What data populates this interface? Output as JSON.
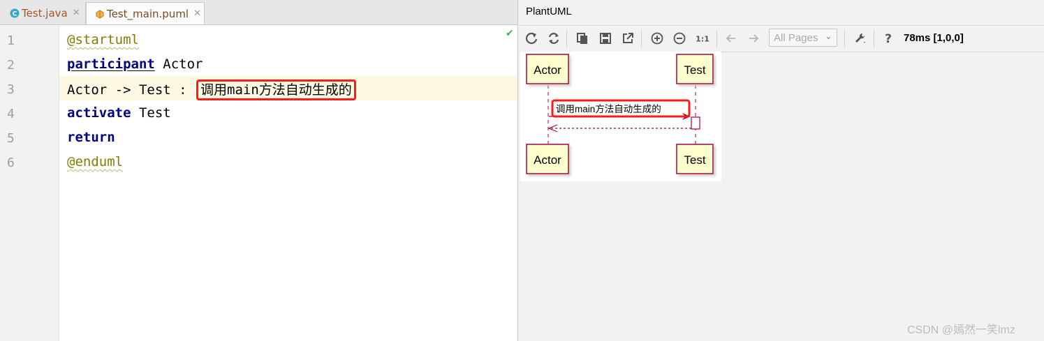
{
  "editor": {
    "tabs": [
      {
        "label": "Test.java",
        "icon": "java-class-icon",
        "active": false
      },
      {
        "label": "Test_main.puml",
        "icon": "puml-file-icon",
        "active": true
      }
    ],
    "line_numbers": [
      "1",
      "2",
      "3",
      "4",
      "5",
      "6"
    ],
    "lines": {
      "l1": "@startuml",
      "l2_kw": "participant",
      "l2_rest": " Actor",
      "l3_code": "Actor -> Test : ",
      "l3_highlight": "调用main方法自动生成的",
      "l4_kw": "activate",
      "l4_rest": " Test",
      "l5_kw": "return",
      "l6": "@enduml"
    }
  },
  "plantuml": {
    "title": "PlantUML",
    "page_select": "All Pages",
    "timing": "78ms [1,0,0]",
    "diagram": {
      "participants": [
        "Actor",
        "Test"
      ],
      "message": "调用main方法自动生成的"
    }
  },
  "colors": {
    "highlight_box": "#ff1a1a",
    "participant_fill": "#fefece",
    "participant_border": "#a80036",
    "keyword": "#000080",
    "annotation": "#808000"
  },
  "watermark": "CSDN @嫣然一笑lmz"
}
